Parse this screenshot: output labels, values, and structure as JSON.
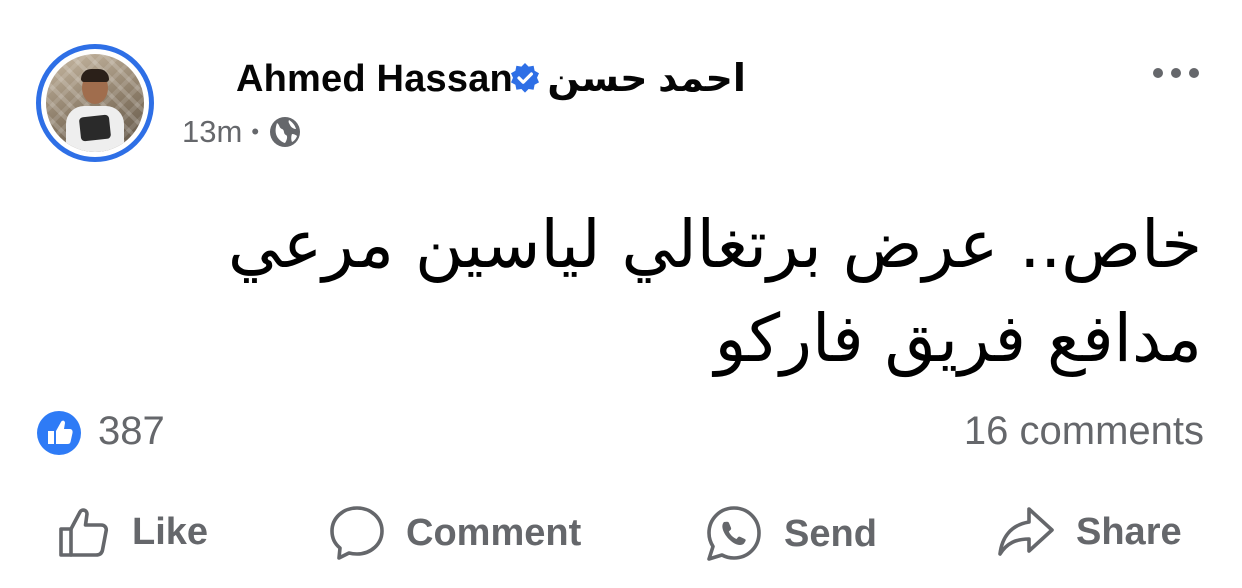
{
  "post": {
    "author": {
      "name": "Ahmed Hassan - احمد حسن",
      "verified": true,
      "avatar": "profile-photo"
    },
    "time": "13m",
    "audience_icon": "globe-icon",
    "more_icon": "more-options-icon",
    "text": "خاص.. عرض برتغالي لياسين مرعي مدافع فريق فاركو",
    "reactions": {
      "icon": "like-icon",
      "count": "387"
    },
    "comments": "16 comments"
  },
  "actions": {
    "like": "Like",
    "comment": "Comment",
    "send": "Send",
    "share": "Share"
  },
  "colors": {
    "accent": "#2e6fe6",
    "like_blue": "#2e7bf6",
    "secondary_text": "#65676b",
    "primary_text": "#050505"
  }
}
